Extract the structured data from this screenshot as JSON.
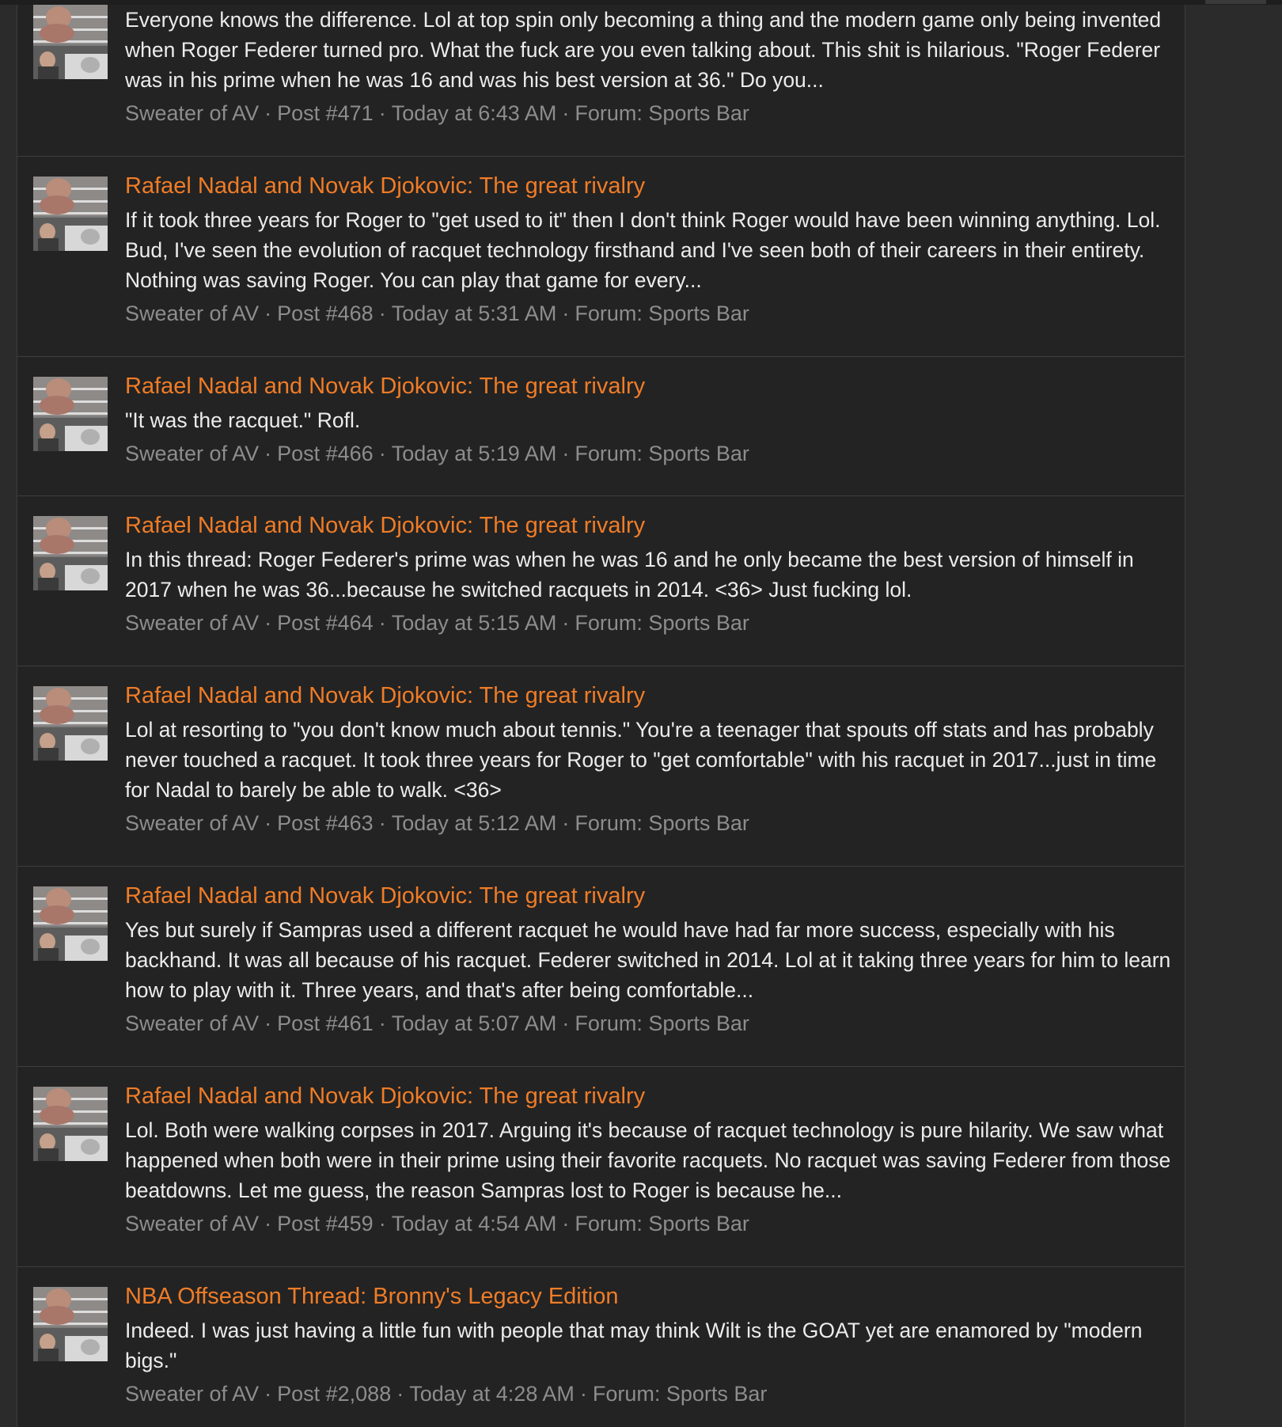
{
  "meta_separator": "·",
  "results": [
    {
      "title": "",
      "snippet": "Everyone knows the difference. Lol at top spin only becoming a thing and the modern game only being invented when Roger Federer turned pro. What the fuck are you even talking about. This shit is hilarious. \"Roger Federer was in his prime when he was 16 and was his best version at 36.\" Do you...",
      "author": "Sweater of AV",
      "post": "Post #471",
      "time": "Today at 6:43 AM",
      "forum": "Forum: Sports Bar"
    },
    {
      "title": "Rafael Nadal and Novak Djokovic: The great rivalry",
      "snippet": "If it took three years for Roger to \"get used to it\" then I don't think Roger would have been winning anything. Lol. Bud, I've seen the evolution of racquet technology firsthand and I've seen both of their careers in their entirety. Nothing was saving Roger. You can play that game for every...",
      "author": "Sweater of AV",
      "post": "Post #468",
      "time": "Today at 5:31 AM",
      "forum": "Forum: Sports Bar"
    },
    {
      "title": "Rafael Nadal and Novak Djokovic: The great rivalry",
      "snippet": "\"It was the racquet.\" Rofl.",
      "author": "Sweater of AV",
      "post": "Post #466",
      "time": "Today at 5:19 AM",
      "forum": "Forum: Sports Bar"
    },
    {
      "title": "Rafael Nadal and Novak Djokovic: The great rivalry",
      "snippet": "In this thread: Roger Federer's prime was when he was 16 and he only became the best version of himself in 2017 when he was 36...because he switched racquets in 2014. <36> Just fucking lol.",
      "author": "Sweater of AV",
      "post": "Post #464",
      "time": "Today at 5:15 AM",
      "forum": "Forum: Sports Bar"
    },
    {
      "title": "Rafael Nadal and Novak Djokovic: The great rivalry",
      "snippet": "Lol at resorting to \"you don't know much about tennis.\" You're a teenager that spouts off stats and has probably never touched a racquet. It took three years for Roger to \"get comfortable\" with his racquet in 2017...just in time for Nadal to barely be able to walk. <36>",
      "author": "Sweater of AV",
      "post": "Post #463",
      "time": "Today at 5:12 AM",
      "forum": "Forum: Sports Bar"
    },
    {
      "title": "Rafael Nadal and Novak Djokovic: The great rivalry",
      "snippet": "Yes but surely if Sampras used a different racquet he would have had far more success, especially with his backhand. It was all because of his racquet. Federer switched in 2014. Lol at it taking three years for him to learn how to play with it. Three years, and that's after being comfortable...",
      "author": "Sweater of AV",
      "post": "Post #461",
      "time": "Today at 5:07 AM",
      "forum": "Forum: Sports Bar"
    },
    {
      "title": "Rafael Nadal and Novak Djokovic: The great rivalry",
      "snippet": "Lol. Both were walking corpses in 2017. Arguing it's because of racquet technology is pure hilarity. We saw what happened when both were in their prime using their favorite racquets. No racquet was saving Federer from those beatdowns. Let me guess, the reason Sampras lost to Roger is because he...",
      "author": "Sweater of AV",
      "post": "Post #459",
      "time": "Today at 4:54 AM",
      "forum": "Forum: Sports Bar"
    },
    {
      "title": "NBA Offseason Thread: Bronny's Legacy Edition",
      "snippet": "Indeed. I was just having a little fun with people that may think Wilt is the GOAT yet are enamored by \"modern bigs.\"",
      "author": "Sweater of AV",
      "post": "Post #2,088",
      "time": "Today at 4:28 AM",
      "forum": "Forum: Sports Bar"
    }
  ],
  "colors": {
    "page_background": "#2b2b2b",
    "panel_background": "#232323",
    "title_link": "#f07c27",
    "snippet_text": "#ececec",
    "meta_text": "#8d8d8d",
    "divider": "#3e3e3e"
  }
}
